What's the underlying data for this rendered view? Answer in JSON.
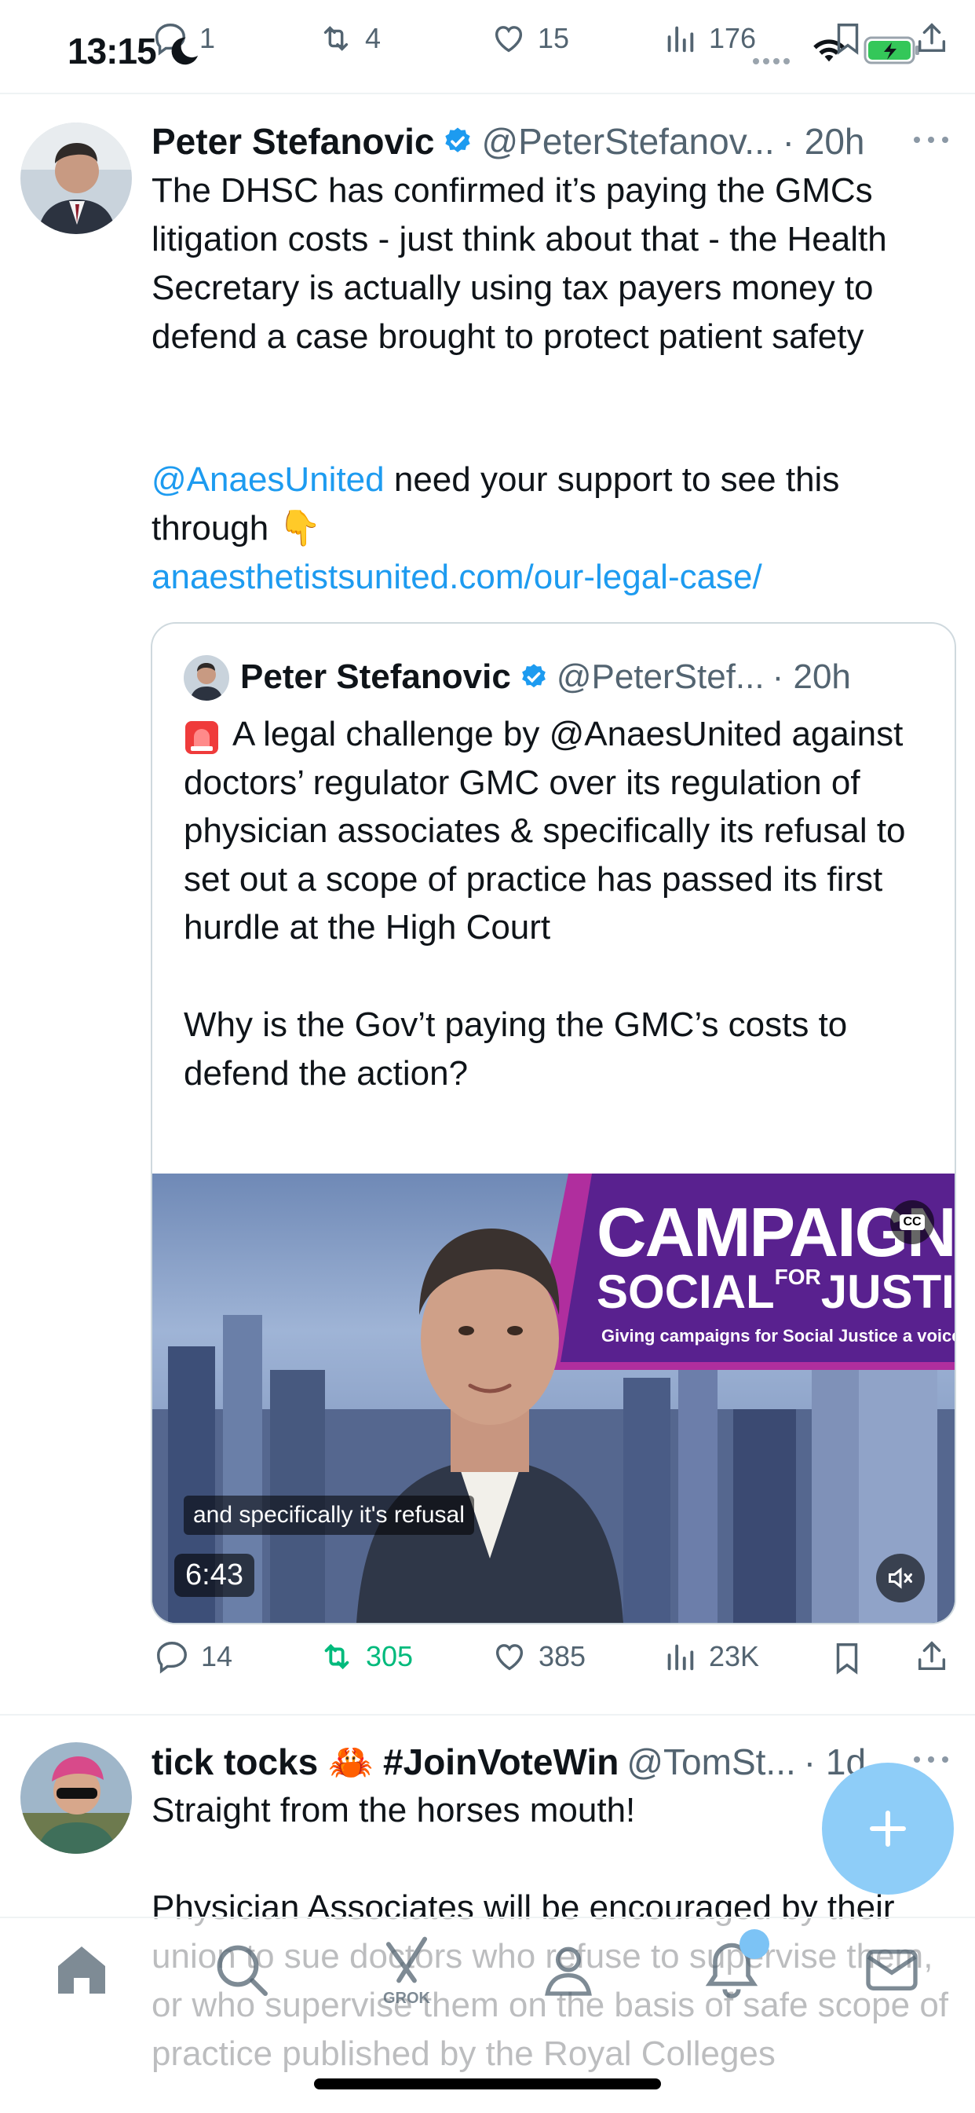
{
  "status_bar": {
    "time": "13:15"
  },
  "prev_tweet_metrics": {
    "replies": "1",
    "reposts": "4",
    "likes": "15",
    "views": "176"
  },
  "tweet1": {
    "author": "Peter Stefanovic",
    "handle": "@PeterStefanov...",
    "time": "· 20h",
    "text_main": "The DHSC has confirmed it’s paying the GMCs litigation costs - just think about that - the Health Secretary is actually using tax payers money to defend a case brought to protect patient safety",
    "mention": "@AnaesUnited",
    "text_after_mention": " need your support to see this through ",
    "emoji": "👇",
    "url": "anaesthetistsunited.com/our-legal-case/",
    "quote": {
      "author": "Peter Stefanovic",
      "handle": "@PeterStef...",
      "time": "· 20h",
      "text_p1": "A legal challenge by @AnaesUnited against doctors’ regulator GMC over its regulation of physician associates & specifically its refusal to set out a scope of practice has passed its first hurdle at the High Court",
      "text_p2": "Why is the Gov’t paying the GMC’s costs to defend the action?",
      "video": {
        "banner_title": "CAMPAIGN",
        "banner_subtitle_a": "SOCIAL",
        "banner_subtitle_for": "FOR",
        "banner_subtitle_b": "JUSTICE",
        "banner_tagline": "Giving campaigns for Social Justice a voice",
        "caption": "and specifically it's refusal",
        "duration": "6:43",
        "cc_label": "CC"
      }
    },
    "metrics": {
      "replies": "14",
      "reposts": "305",
      "likes": "385",
      "views": "23K"
    }
  },
  "tweet2": {
    "author": "tick tocks 🦀 #JoinVoteWin",
    "handle": "@TomSt...",
    "time": "· 1d",
    "text_p1": "Straight from the horses mouth!",
    "text_p2": "Physician Associates will be encouraged by their union to sue doctors who refuse to supervise them, or who supervise them on the basis of safe scope of practice published by the Royal Colleges"
  },
  "tabbar": {
    "grok_label": "GROK"
  },
  "colors": {
    "accent": "#1d9bf0",
    "repost_green": "#00ba7c",
    "fab": "#8ecdf8",
    "muted": "#536471"
  }
}
